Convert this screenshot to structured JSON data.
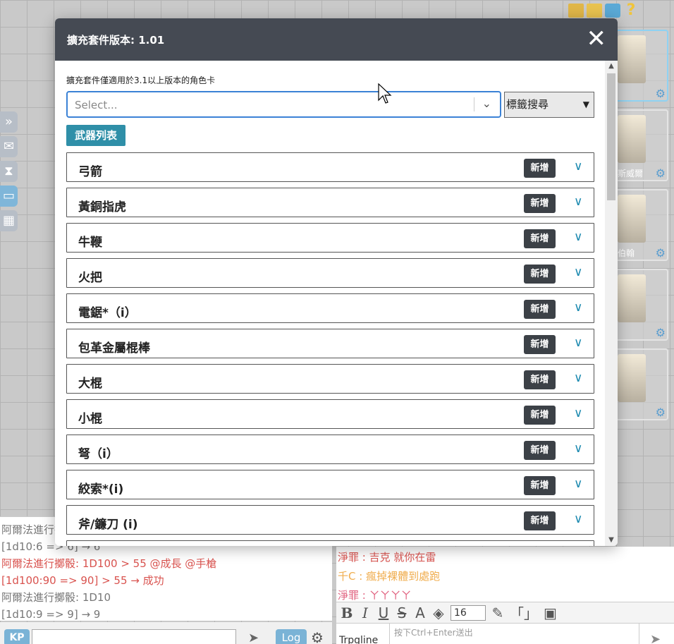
{
  "modal": {
    "title": "擴充套件版本: 1.01",
    "close": "✕",
    "notice": "擴充套件僅適用於3.1以上版本的角色卡",
    "select_placeholder": "Select...",
    "tag_search": "標籤搜尋",
    "list_tag": "武器列表",
    "add_label": "新增",
    "weapons": [
      "弓箭",
      "黃銅指虎",
      "牛鞭",
      "火把",
      "電鋸*（i）",
      "包革金屬棍棒",
      "大棍",
      "小棍",
      "弩（i）",
      "絞索*(i)",
      "斧/鐮刀 (i)"
    ]
  },
  "characters": [
    {
      "name": ""
    },
    {
      "name": "斯威爾"
    },
    {
      "name": "伯翰"
    },
    {
      "name": ""
    },
    {
      "name": ""
    }
  ],
  "chat_left": {
    "messages": [
      {
        "text": "阿爾法進行擲",
        "color": "#777777"
      },
      {
        "text": "[1d10:6 => 6] → 6",
        "color": "#777777"
      },
      {
        "text": "阿爾法進行擲骰: 1D100 > 55 @成長 @手槍",
        "color": "#d9534f"
      },
      {
        "text": "[1d100:90 => 90] > 55 → 成功",
        "color": "#d9534f"
      },
      {
        "text": "阿爾法進行擲骰: 1D10",
        "color": "#777777"
      },
      {
        "text": "[1d10:9 => 9] → 9",
        "color": "#777777"
      }
    ],
    "kp": "KP",
    "log": "Log"
  },
  "chat_right": {
    "messages": [
      {
        "text": "淨罪 : 吉克 就你在雷",
        "color": "#d9534f"
      },
      {
        "text": "千C : 瘋掉裸體到處跑",
        "color": "#f0ad4e"
      },
      {
        "text": "淨罪 : ㄚㄚㄚㄚ",
        "color": "#e0607e"
      }
    ],
    "font_size": "16",
    "mode": "Trpgline",
    "input_hint": "按下Ctrl+Enter送出"
  },
  "colors": {
    "modal_header": "#454a53",
    "select_focus": "#3b82d6",
    "list_tag": "#2f8fa8",
    "add_button": "#3c4147",
    "expand_icon": "#1d8ab0"
  }
}
